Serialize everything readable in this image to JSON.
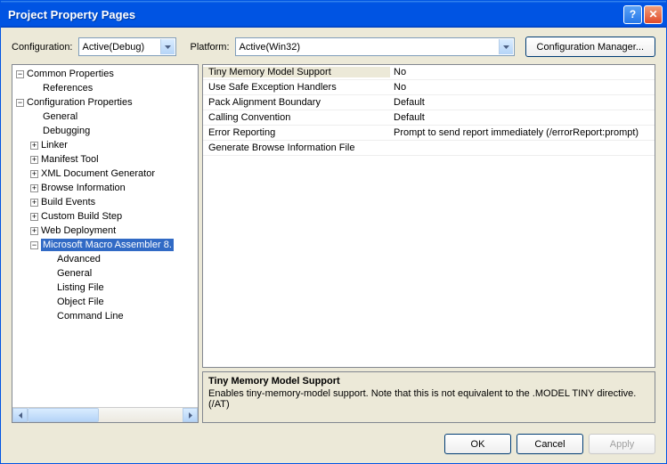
{
  "titlebar": {
    "title": "Project Property Pages"
  },
  "toprow": {
    "config_label": "Configuration:",
    "config_value": "Active(Debug)",
    "platform_label": "Platform:",
    "platform_value": "Active(Win32)",
    "config_mgr_label": "Configuration Manager..."
  },
  "tree": {
    "items": [
      {
        "level": 0,
        "exp": "-",
        "label": "Common Properties",
        "sel": false
      },
      {
        "level": 1,
        "exp": "",
        "label": "References",
        "sel": false
      },
      {
        "level": 0,
        "exp": "-",
        "label": "Configuration Properties",
        "sel": false
      },
      {
        "level": 1,
        "exp": "",
        "label": "General",
        "sel": false
      },
      {
        "level": 1,
        "exp": "",
        "label": "Debugging",
        "sel": false
      },
      {
        "level": 1,
        "exp": "+",
        "label": "Linker",
        "sel": false
      },
      {
        "level": 1,
        "exp": "+",
        "label": "Manifest Tool",
        "sel": false
      },
      {
        "level": 1,
        "exp": "+",
        "label": "XML Document Generator",
        "sel": false
      },
      {
        "level": 1,
        "exp": "+",
        "label": "Browse Information",
        "sel": false
      },
      {
        "level": 1,
        "exp": "+",
        "label": "Build Events",
        "sel": false
      },
      {
        "level": 1,
        "exp": "+",
        "label": "Custom Build Step",
        "sel": false
      },
      {
        "level": 1,
        "exp": "+",
        "label": "Web Deployment",
        "sel": false
      },
      {
        "level": 1,
        "exp": "-",
        "label": "Microsoft Macro Assembler 8.",
        "sel": true
      },
      {
        "level": 2,
        "exp": "",
        "label": "Advanced",
        "sel": false
      },
      {
        "level": 2,
        "exp": "",
        "label": "General",
        "sel": false
      },
      {
        "level": 2,
        "exp": "",
        "label": "Listing File",
        "sel": false
      },
      {
        "level": 2,
        "exp": "",
        "label": "Object File",
        "sel": false
      },
      {
        "level": 2,
        "exp": "",
        "label": "Command Line",
        "sel": false
      }
    ]
  },
  "grid": {
    "rows": [
      {
        "key": "Tiny Memory Model Support",
        "value": "No",
        "selected": true
      },
      {
        "key": "Use Safe Exception Handlers",
        "value": "No",
        "selected": false
      },
      {
        "key": "Pack Alignment Boundary",
        "value": "Default",
        "selected": false
      },
      {
        "key": "Calling Convention",
        "value": "Default",
        "selected": false
      },
      {
        "key": "Error Reporting",
        "value": "Prompt to send report immediately (/errorReport:prompt)",
        "selected": false
      },
      {
        "key": "Generate Browse Information File",
        "value": "",
        "selected": false
      }
    ]
  },
  "desc": {
    "title": "Tiny Memory Model Support",
    "body": "Enables tiny-memory-model support. Note that this is not equivalent to the .MODEL TINY directive.     (/AT)"
  },
  "buttons": {
    "ok": "OK",
    "cancel": "Cancel",
    "apply": "Apply"
  }
}
